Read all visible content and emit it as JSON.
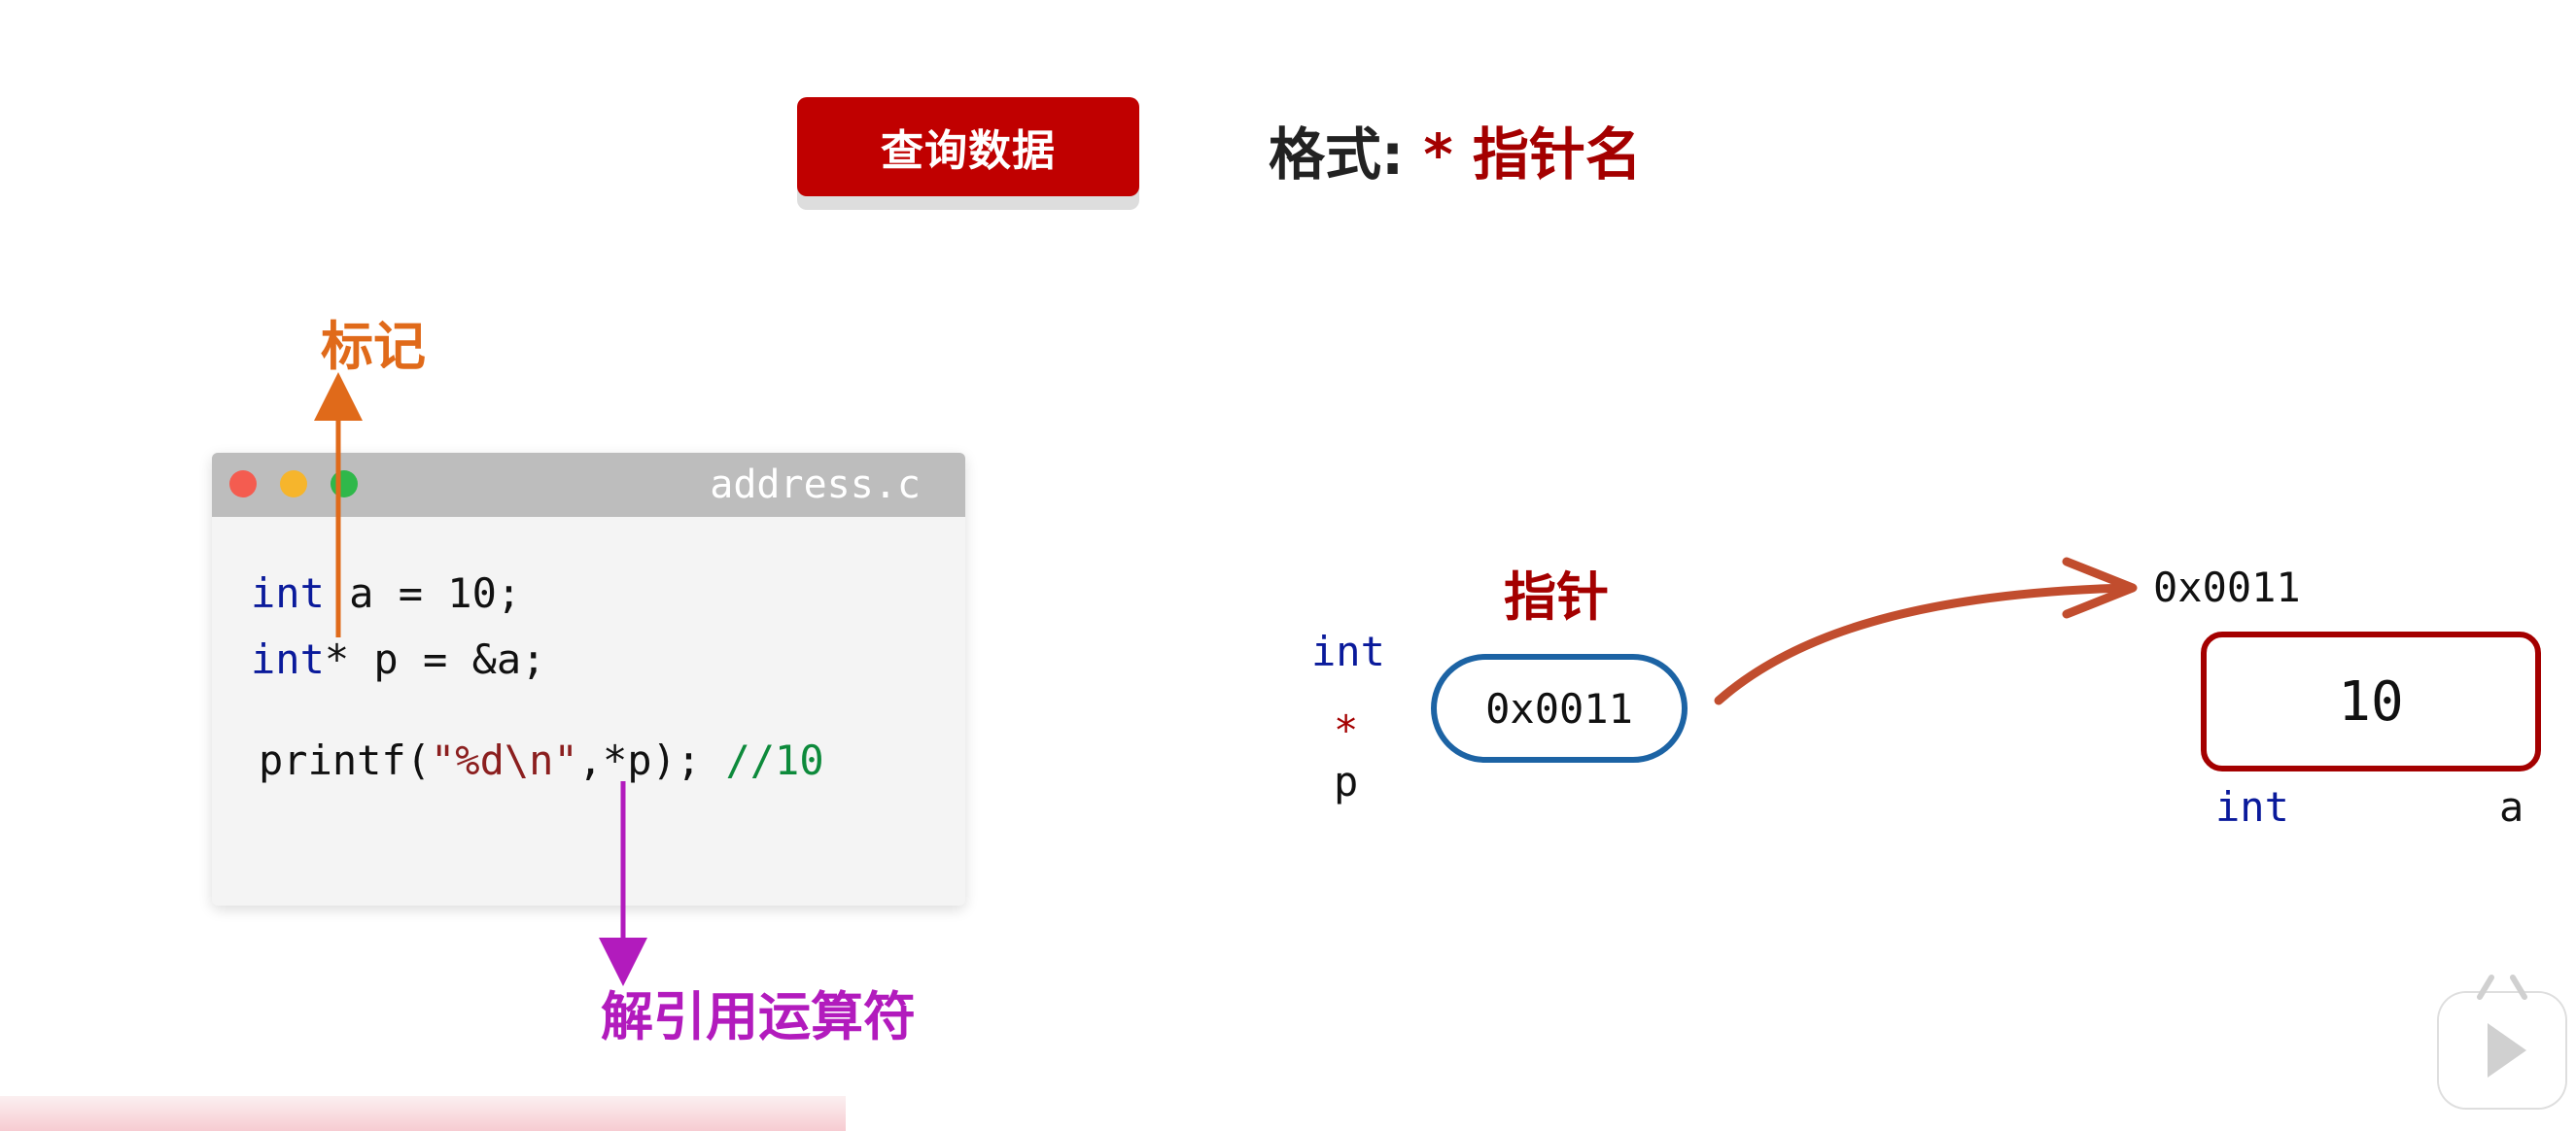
{
  "header": {
    "button_label": "查询数据",
    "format_prefix": "格式:",
    "format_value": "* 指针名"
  },
  "annotations": {
    "mark_label": "标记",
    "deref_label": "解引用运算符"
  },
  "code_window": {
    "filename": "address.c",
    "line1": {
      "keyword": "int",
      "rest": " a = 10;"
    },
    "line2": {
      "keyword": "int",
      "rest": "* p = &a;"
    },
    "line3": {
      "function": "printf(",
      "format_string": "\"%d\\n\"",
      "after_format": ",*p);",
      "comment": "//10"
    }
  },
  "diagram": {
    "pointer_title": "指针",
    "pointer_type": "int",
    "pointer_star": "*",
    "pointer_name": "p",
    "pointer_value": "0x0011",
    "target_address": "0x0011",
    "target_value": "10",
    "target_type": "int",
    "target_name": "a"
  },
  "colors": {
    "header_red": "#c00000",
    "dark_red": "#a40000",
    "orange": "#e06a1a",
    "purple": "#b21bbd",
    "blue_keyword": "#0a1a9b",
    "pointer_outline": "#1c63a4",
    "comment_green": "#0d8a3b"
  },
  "icons": {
    "close_dot": "red-dot-icon",
    "minimize_dot": "yellow-dot-icon",
    "maximize_dot": "green-dot-icon",
    "play_control": "play-button-icon"
  }
}
